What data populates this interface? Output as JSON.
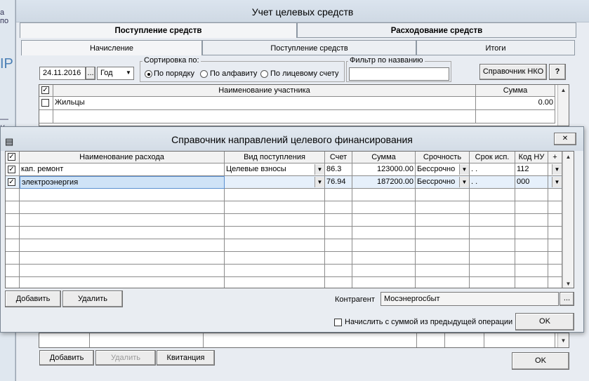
{
  "background_app": {
    "fragments": [
      "а по",
      "ІР",
      "— К"
    ]
  },
  "window": {
    "title": "Учет целевых средств"
  },
  "main_tabs": [
    "Поступление средств",
    "Расходование средств"
  ],
  "sub_tabs": [
    "Начисление",
    "Поступление средств",
    "Итоги"
  ],
  "filters": {
    "date": "24.11.2016",
    "date_btn": "...",
    "period": "Год",
    "sort_label": "Сортировка по:",
    "sort_options": [
      "По порядку",
      "По алфавиту",
      "По лицевому счету"
    ],
    "sort_selected": 0,
    "name_filter_label": "Фильтр по названию",
    "name_filter_value": "",
    "nko_button": "Справочник НКО",
    "help_button": "?"
  },
  "main_grid": {
    "columns": [
      "Наименование участника",
      "Сумма"
    ],
    "rows": [
      {
        "name": "Жильцы",
        "sum": "0.00"
      }
    ]
  },
  "main_bottom": {
    "add": "Добавить",
    "delete": "Удалить",
    "receipt": "Квитанция",
    "ok": "OK"
  },
  "dialog": {
    "title": "Справочник направлений целевого финансирования",
    "close": "✕",
    "columns": [
      "Наименование расхода",
      "Вид поступления",
      "Счет",
      "Сумма",
      "Срочность",
      "Срок исп.",
      "Код НУ",
      "+"
    ],
    "rows": [
      {
        "checked": true,
        "name": "кап. ремонт",
        "type": "Целевые взносы",
        "account": "86.3",
        "sum": "123000.00",
        "urgency": "Бессрочно",
        "term": ". .",
        "code": "112"
      },
      {
        "checked": true,
        "name": "электроэнергия",
        "type": "",
        "account": "76.94",
        "sum": "187200.00",
        "urgency": "Бессрочно",
        "term": ". .",
        "code": "000"
      }
    ],
    "add": "Добавить",
    "delete": "Удалить",
    "contragent_label": "Контрагент",
    "contragent_value": "Мосэнергосбыт",
    "contragent_btn": "...",
    "prev_sum_label": "Начислить с суммой из предыдущей операции",
    "ok": "OK"
  }
}
